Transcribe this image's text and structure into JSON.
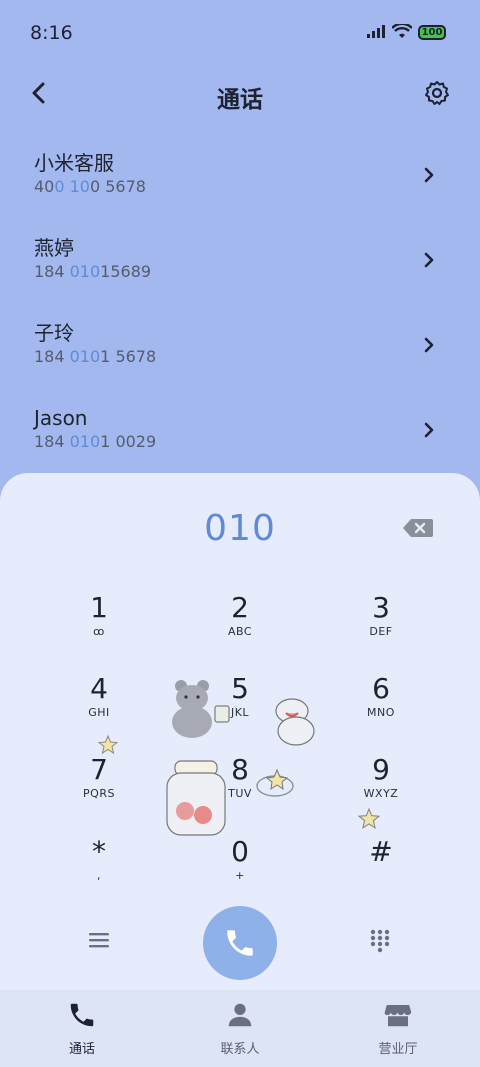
{
  "status": {
    "time": "8:16",
    "battery": "100"
  },
  "header": {
    "title": "通话",
    "back_icon": "chevron-left-icon",
    "settings_icon": "gear-icon"
  },
  "calls": [
    {
      "name": "小米客服",
      "number_parts": [
        "40",
        "0 10",
        "0 5678"
      ]
    },
    {
      "name": "燕婷",
      "number_parts": [
        "184 ",
        "010",
        "15689"
      ]
    },
    {
      "name": "子玲",
      "number_parts": [
        "184 ",
        "010",
        "1 5678"
      ]
    },
    {
      "name": "Jason",
      "number_parts": [
        "184 ",
        "010",
        "1 0029"
      ]
    }
  ],
  "dialer": {
    "input": "010",
    "keys": [
      {
        "digit": "1",
        "letters": "ꝏ"
      },
      {
        "digit": "2",
        "letters": "ABC"
      },
      {
        "digit": "3",
        "letters": "DEF"
      },
      {
        "digit": "4",
        "letters": "GHI"
      },
      {
        "digit": "5",
        "letters": "JKL"
      },
      {
        "digit": "6",
        "letters": "MNO"
      },
      {
        "digit": "7",
        "letters": "PQRS"
      },
      {
        "digit": "8",
        "letters": "TUV"
      },
      {
        "digit": "9",
        "letters": "WXYZ"
      },
      {
        "digit": "*",
        "letters": ","
      },
      {
        "digit": "0",
        "letters": "+"
      },
      {
        "digit": "#",
        "letters": ""
      }
    ]
  },
  "colors": {
    "accent": "#5f8ad6",
    "call_button": "#8eb1ea",
    "background": "#a3b8ef",
    "panel": "#e6ecfb"
  },
  "tabs": [
    {
      "label": "通话",
      "icon": "phone-icon",
      "active": true
    },
    {
      "label": "联系人",
      "icon": "person-icon",
      "active": false
    },
    {
      "label": "营业厅",
      "icon": "store-icon",
      "active": false
    }
  ]
}
